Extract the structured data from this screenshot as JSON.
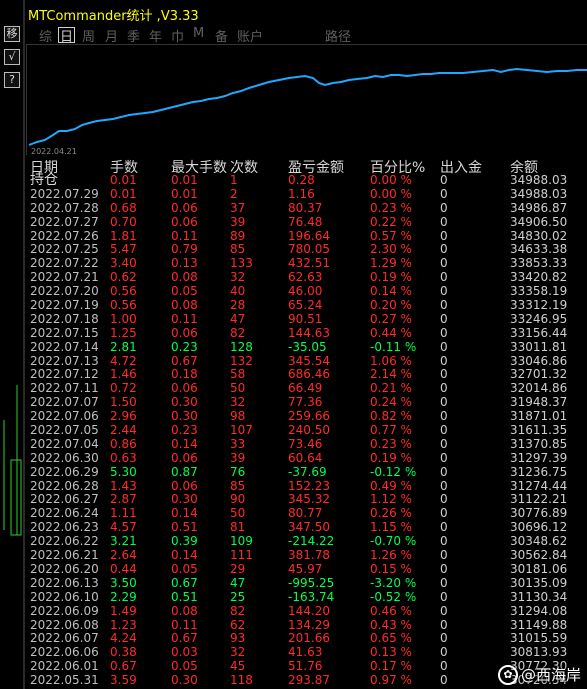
{
  "window": {
    "title": "MTCommander统计 ,V3.33"
  },
  "toolbar": {
    "buttons": [
      "移",
      "√",
      "?"
    ]
  },
  "tabs": [
    {
      "label": "综",
      "active": false
    },
    {
      "label": "日",
      "active": true
    },
    {
      "label": "周",
      "active": false
    },
    {
      "label": "月",
      "active": false
    },
    {
      "label": "季",
      "active": false
    },
    {
      "label": "年",
      "active": false
    },
    {
      "label": "巾",
      "active": false
    },
    {
      "label": "M",
      "active": false
    },
    {
      "label": "备",
      "active": false
    },
    {
      "label": "账户",
      "active": false
    },
    {
      "label": "路径",
      "active": false
    }
  ],
  "chart": {
    "start_date": "2022.04.21",
    "line_color": "#1fa8ff"
  },
  "table": {
    "headers": [
      "日期",
      "手数",
      "最大手数",
      "次数",
      "盈亏金额",
      "百分比%",
      "出入金",
      "余额"
    ],
    "holding_label": "持仓",
    "holding": {
      "lots": "0.01",
      "max_lots": "0.01",
      "count": "1",
      "pnl": "0.28",
      "pct": "0.00 %",
      "flow": "0",
      "balance": "34988.03"
    },
    "rows": [
      {
        "date": "2022.07.29",
        "lots": "0.01",
        "max": "0.01",
        "count": "2",
        "pnl": "1.16",
        "pct": "0.00 %",
        "flow": "0",
        "balance": "34988.03",
        "dir": "red"
      },
      {
        "date": "2022.07.28",
        "lots": "0.68",
        "max": "0.06",
        "count": "37",
        "pnl": "80.37",
        "pct": "0.23 %",
        "flow": "0",
        "balance": "34986.87",
        "dir": "red"
      },
      {
        "date": "2022.07.27",
        "lots": "0.70",
        "max": "0.06",
        "count": "39",
        "pnl": "76.48",
        "pct": "0.22 %",
        "flow": "0",
        "balance": "34906.50",
        "dir": "red"
      },
      {
        "date": "2022.07.26",
        "lots": "1.81",
        "max": "0.11",
        "count": "89",
        "pnl": "196.64",
        "pct": "0.57 %",
        "flow": "0",
        "balance": "34830.02",
        "dir": "red"
      },
      {
        "date": "2022.07.25",
        "lots": "5.47",
        "max": "0.79",
        "count": "85",
        "pnl": "780.05",
        "pct": "2.30 %",
        "flow": "0",
        "balance": "34633.38",
        "dir": "red"
      },
      {
        "date": "2022.07.22",
        "lots": "3.40",
        "max": "0.13",
        "count": "133",
        "pnl": "432.51",
        "pct": "1.29 %",
        "flow": "0",
        "balance": "33853.33",
        "dir": "red"
      },
      {
        "date": "2022.07.21",
        "lots": "0.62",
        "max": "0.08",
        "count": "32",
        "pnl": "62.63",
        "pct": "0.19 %",
        "flow": "0",
        "balance": "33420.82",
        "dir": "red"
      },
      {
        "date": "2022.07.20",
        "lots": "0.56",
        "max": "0.05",
        "count": "40",
        "pnl": "46.00",
        "pct": "0.14 %",
        "flow": "0",
        "balance": "33358.19",
        "dir": "red"
      },
      {
        "date": "2022.07.19",
        "lots": "0.56",
        "max": "0.08",
        "count": "28",
        "pnl": "65.24",
        "pct": "0.20 %",
        "flow": "0",
        "balance": "33312.19",
        "dir": "red"
      },
      {
        "date": "2022.07.18",
        "lots": "1.00",
        "max": "0.11",
        "count": "47",
        "pnl": "90.51",
        "pct": "0.27 %",
        "flow": "0",
        "balance": "33246.95",
        "dir": "red"
      },
      {
        "date": "2022.07.15",
        "lots": "1.25",
        "max": "0.06",
        "count": "82",
        "pnl": "144.63",
        "pct": "0.44 %",
        "flow": "0",
        "balance": "33156.44",
        "dir": "red"
      },
      {
        "date": "2022.07.14",
        "lots": "2.81",
        "max": "0.23",
        "count": "128",
        "pnl": "-35.05",
        "pct": "-0.11 %",
        "flow": "0",
        "balance": "33011.81",
        "dir": "green"
      },
      {
        "date": "2022.07.13",
        "lots": "4.72",
        "max": "0.67",
        "count": "132",
        "pnl": "345.54",
        "pct": "1.06 %",
        "flow": "0",
        "balance": "33046.86",
        "dir": "red"
      },
      {
        "date": "2022.07.12",
        "lots": "1.46",
        "max": "0.18",
        "count": "58",
        "pnl": "686.46",
        "pct": "2.14 %",
        "flow": "0",
        "balance": "32701.32",
        "dir": "red"
      },
      {
        "date": "2022.07.11",
        "lots": "0.72",
        "max": "0.06",
        "count": "50",
        "pnl": "66.49",
        "pct": "0.21 %",
        "flow": "0",
        "balance": "32014.86",
        "dir": "red"
      },
      {
        "date": "2022.07.07",
        "lots": "1.50",
        "max": "0.30",
        "count": "32",
        "pnl": "77.36",
        "pct": "0.24 %",
        "flow": "0",
        "balance": "31948.37",
        "dir": "red"
      },
      {
        "date": "2022.07.06",
        "lots": "2.96",
        "max": "0.30",
        "count": "98",
        "pnl": "259.66",
        "pct": "0.82 %",
        "flow": "0",
        "balance": "31871.01",
        "dir": "red"
      },
      {
        "date": "2022.07.05",
        "lots": "2.44",
        "max": "0.23",
        "count": "107",
        "pnl": "240.50",
        "pct": "0.77 %",
        "flow": "0",
        "balance": "31611.35",
        "dir": "red"
      },
      {
        "date": "2022.07.04",
        "lots": "0.86",
        "max": "0.14",
        "count": "33",
        "pnl": "73.46",
        "pct": "0.23 %",
        "flow": "0",
        "balance": "31370.85",
        "dir": "red"
      },
      {
        "date": "2022.06.30",
        "lots": "0.63",
        "max": "0.06",
        "count": "39",
        "pnl": "60.64",
        "pct": "0.19 %",
        "flow": "0",
        "balance": "31297.39",
        "dir": "red"
      },
      {
        "date": "2022.06.29",
        "lots": "5.30",
        "max": "0.87",
        "count": "76",
        "pnl": "-37.69",
        "pct": "-0.12 %",
        "flow": "0",
        "balance": "31236.75",
        "dir": "green"
      },
      {
        "date": "2022.06.28",
        "lots": "1.43",
        "max": "0.06",
        "count": "85",
        "pnl": "152.23",
        "pct": "0.49 %",
        "flow": "0",
        "balance": "31274.44",
        "dir": "red"
      },
      {
        "date": "2022.06.27",
        "lots": "2.87",
        "max": "0.30",
        "count": "90",
        "pnl": "345.32",
        "pct": "1.12 %",
        "flow": "0",
        "balance": "31122.21",
        "dir": "red"
      },
      {
        "date": "2022.06.24",
        "lots": "1.11",
        "max": "0.14",
        "count": "50",
        "pnl": "80.77",
        "pct": "0.26 %",
        "flow": "0",
        "balance": "30776.89",
        "dir": "red"
      },
      {
        "date": "2022.06.23",
        "lots": "4.57",
        "max": "0.51",
        "count": "81",
        "pnl": "347.50",
        "pct": "1.15 %",
        "flow": "0",
        "balance": "30696.12",
        "dir": "red"
      },
      {
        "date": "2022.06.22",
        "lots": "3.21",
        "max": "0.39",
        "count": "109",
        "pnl": "-214.22",
        "pct": "-0.70 %",
        "flow": "0",
        "balance": "30348.62",
        "dir": "green"
      },
      {
        "date": "2022.06.21",
        "lots": "2.64",
        "max": "0.14",
        "count": "111",
        "pnl": "381.78",
        "pct": "1.26 %",
        "flow": "0",
        "balance": "30562.84",
        "dir": "red"
      },
      {
        "date": "2022.06.20",
        "lots": "0.44",
        "max": "0.05",
        "count": "29",
        "pnl": "45.97",
        "pct": "0.15 %",
        "flow": "0",
        "balance": "30181.06",
        "dir": "red"
      },
      {
        "date": "2022.06.13",
        "lots": "3.50",
        "max": "0.67",
        "count": "47",
        "pnl": "-995.25",
        "pct": "-3.20 %",
        "flow": "0",
        "balance": "30135.09",
        "dir": "green"
      },
      {
        "date": "2022.06.10",
        "lots": "2.29",
        "max": "0.51",
        "count": "25",
        "pnl": "-163.74",
        "pct": "-0.52 %",
        "flow": "0",
        "balance": "31130.34",
        "dir": "green"
      },
      {
        "date": "2022.06.09",
        "lots": "1.49",
        "max": "0.08",
        "count": "82",
        "pnl": "144.20",
        "pct": "0.46 %",
        "flow": "0",
        "balance": "31294.08",
        "dir": "red"
      },
      {
        "date": "2022.06.08",
        "lots": "1.23",
        "max": "0.11",
        "count": "62",
        "pnl": "134.29",
        "pct": "0.43 %",
        "flow": "0",
        "balance": "31149.88",
        "dir": "red"
      },
      {
        "date": "2022.06.07",
        "lots": "4.24",
        "max": "0.67",
        "count": "93",
        "pnl": "201.66",
        "pct": "0.65 %",
        "flow": "0",
        "balance": "31015.59",
        "dir": "red"
      },
      {
        "date": "2022.06.06",
        "lots": "0.38",
        "max": "0.03",
        "count": "32",
        "pnl": "41.63",
        "pct": "0.13 %",
        "flow": "0",
        "balance": "30813.93",
        "dir": "red"
      },
      {
        "date": "2022.06.01",
        "lots": "0.67",
        "max": "0.05",
        "count": "45",
        "pnl": "51.76",
        "pct": "0.17 %",
        "flow": "0",
        "balance": "30772.30",
        "dir": "red"
      },
      {
        "date": "2022.05.31",
        "lots": "3.59",
        "max": "0.30",
        "count": "118",
        "pnl": "293.87",
        "pct": "0.97 %",
        "flow": "0",
        "balance": "30720.54",
        "dir": "red"
      }
    ]
  },
  "watermark": {
    "text": "@西海岸"
  }
}
